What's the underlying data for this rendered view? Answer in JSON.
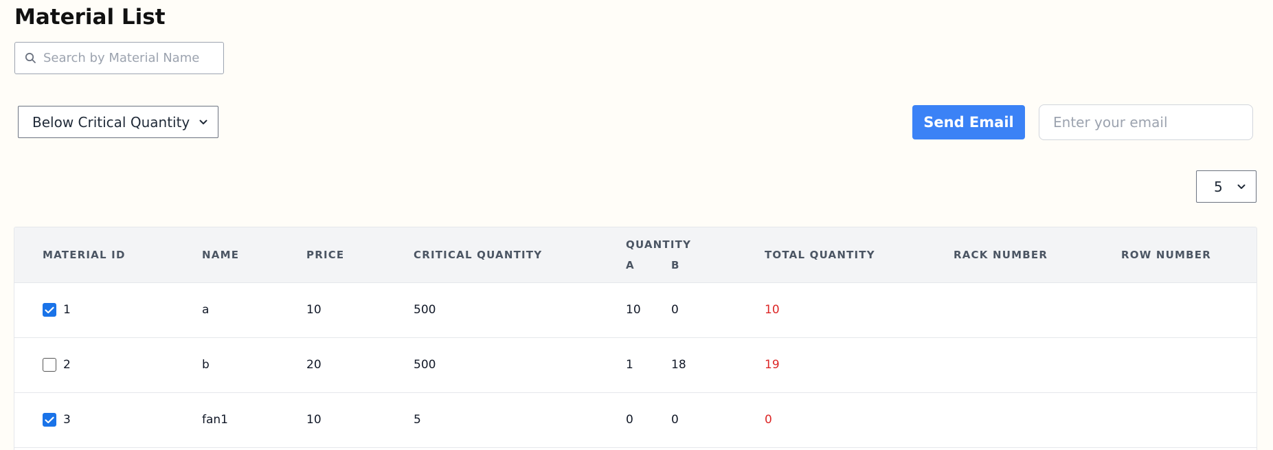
{
  "page": {
    "title": "Material List"
  },
  "search": {
    "placeholder": "Search by Material Name",
    "value": ""
  },
  "filter": {
    "selected": "Below Critical Quantity"
  },
  "email": {
    "button_label": "Send Email",
    "placeholder": "Enter your email",
    "value": ""
  },
  "pagination": {
    "page_size": "5"
  },
  "table": {
    "headers": {
      "material_id": "MATERIAL ID",
      "name": "NAME",
      "price": "PRICE",
      "critical_quantity": "CRITICAL QUANTITY",
      "quantity": "QUANTITY",
      "quantity_a": "A",
      "quantity_b": "B",
      "total_quantity": "TOTAL QUANTITY",
      "rack_number": "RACK NUMBER",
      "row_number": "ROW NUMBER"
    },
    "rows": [
      {
        "checked": true,
        "id": "1",
        "name": "a",
        "price": "10",
        "critical": "500",
        "qa": "10",
        "qb": "0",
        "total": "10"
      },
      {
        "checked": false,
        "id": "2",
        "name": "b",
        "price": "20",
        "critical": "500",
        "qa": "1",
        "qb": "18",
        "total": "19"
      },
      {
        "checked": true,
        "id": "3",
        "name": "fan1",
        "price": "10",
        "critical": "5",
        "qa": "0",
        "qb": "0",
        "total": "0"
      }
    ]
  },
  "colors": {
    "accent": "#3b82f6",
    "checkbox": "#1a73e8",
    "below_critical": "#dc2626",
    "background": "#fffdf8",
    "header_bg": "#f3f4f6"
  },
  "icons": {
    "search": "search-icon",
    "dropdown": "chevron-down-icon",
    "check": "check-icon"
  }
}
